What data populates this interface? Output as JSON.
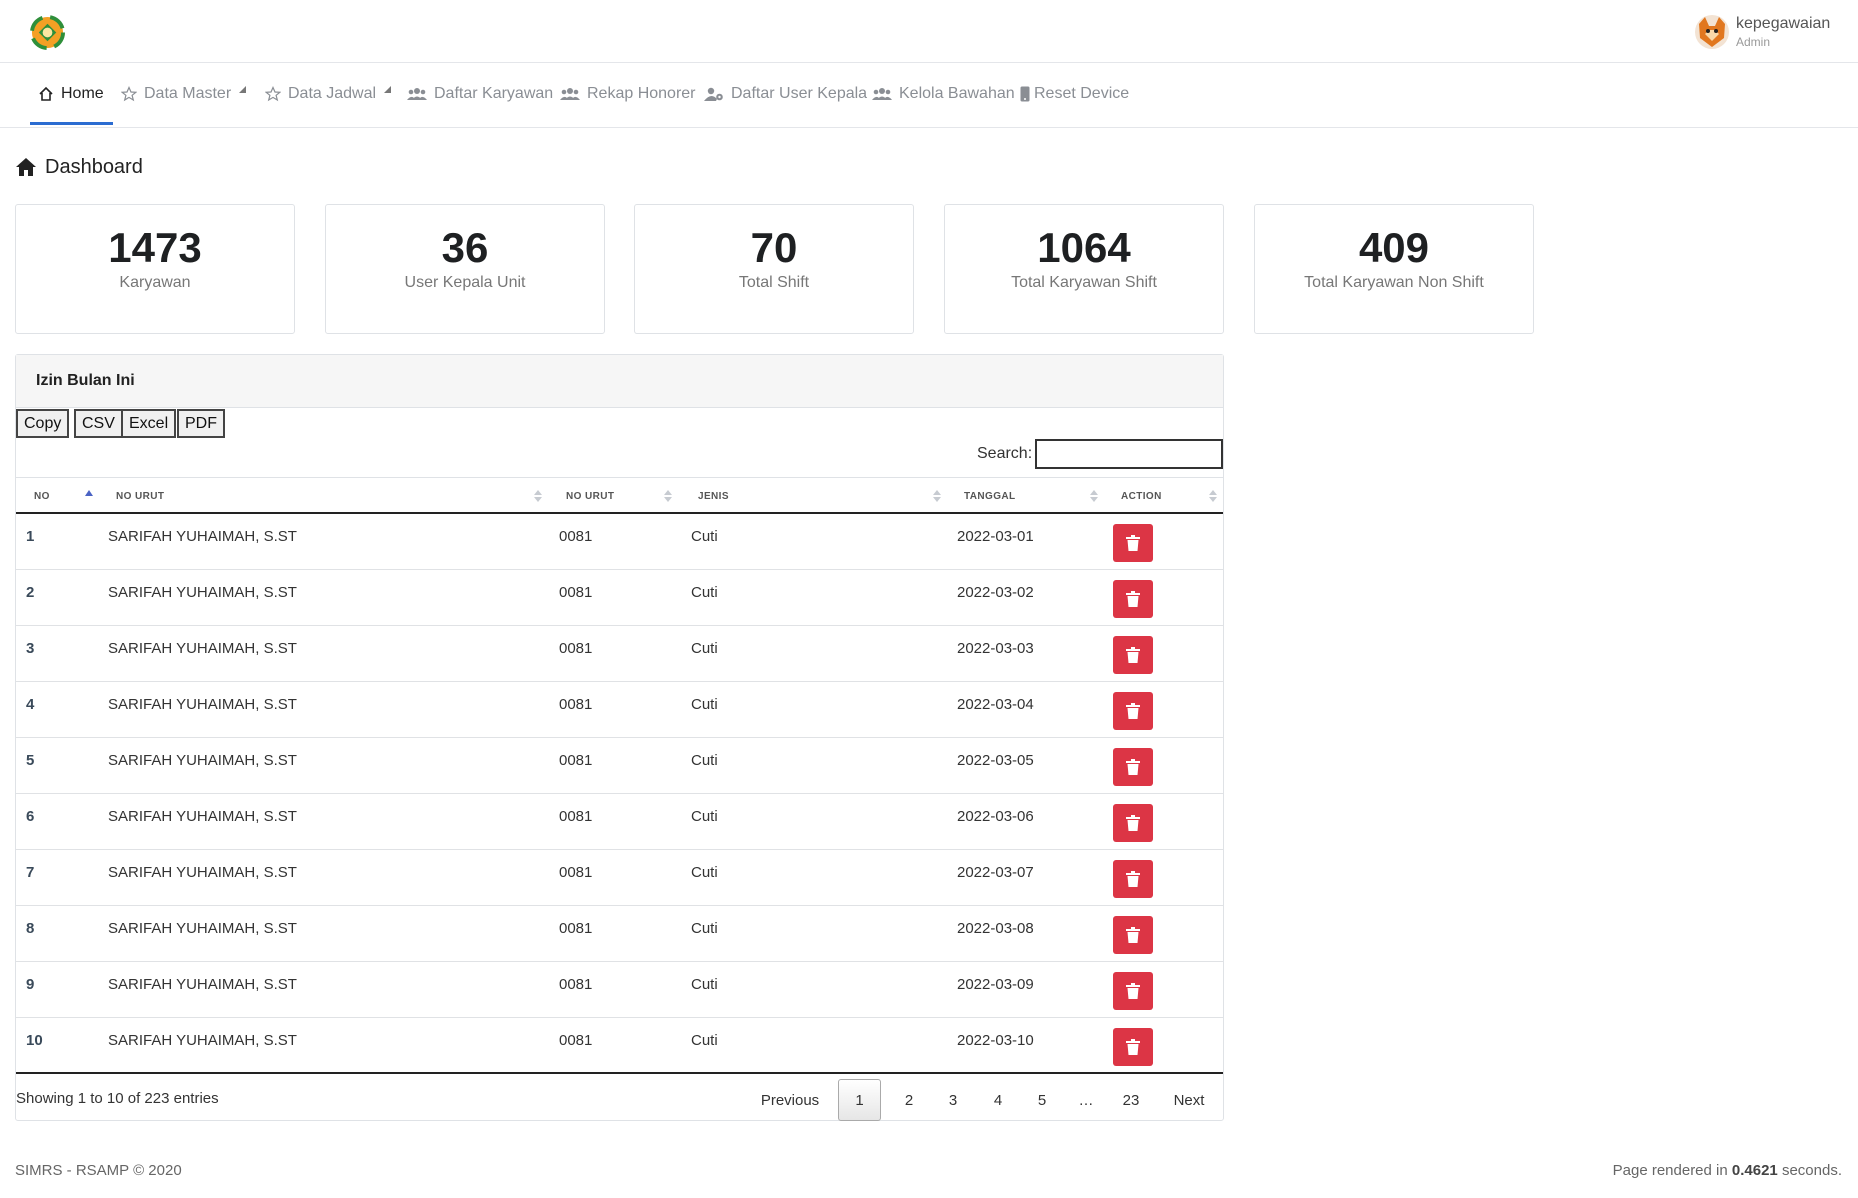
{
  "user": {
    "name": "kepegawaian",
    "role": "Admin"
  },
  "nav": [
    {
      "label": "Home",
      "active": true,
      "icon": "home-icon"
    },
    {
      "label": "Data Master",
      "icon": "star-icon",
      "dropdown": true
    },
    {
      "label": "Data Jadwal",
      "icon": "star-icon",
      "dropdown": true
    },
    {
      "label": "Daftar Karyawan",
      "icon": "users-icon"
    },
    {
      "label": "Rekap Honorer",
      "icon": "users-icon"
    },
    {
      "label": "Daftar User Kepala",
      "icon": "user-cog-icon"
    },
    {
      "label": "Kelola Bawahan",
      "icon": "users-icon"
    },
    {
      "label": "Reset Device",
      "icon": "mobile-icon"
    }
  ],
  "page_title": "Dashboard",
  "stats": [
    {
      "value": "1473",
      "label": "Karyawan"
    },
    {
      "value": "36",
      "label": "User Kepala Unit"
    },
    {
      "value": "70",
      "label": "Total Shift"
    },
    {
      "value": "1064",
      "label": "Total Karyawan Shift"
    },
    {
      "value": "409",
      "label": "Total Karyawan Non Shift"
    }
  ],
  "panel": {
    "title": "Izin Bulan Ini",
    "export_buttons": [
      "Copy",
      "CSV",
      "Excel",
      "PDF"
    ],
    "search_label": "Search:",
    "search_value": "",
    "columns": [
      "NO",
      "NO URUT",
      "NO URUT",
      "JENIS",
      "TANGGAL",
      "ACTION"
    ],
    "rows": [
      {
        "no": "1",
        "nama": "SARIFAH YUHAIMAH, S.ST",
        "no_urut": "0081",
        "jenis": "Cuti",
        "tanggal": "2022-03-01"
      },
      {
        "no": "2",
        "nama": "SARIFAH YUHAIMAH, S.ST",
        "no_urut": "0081",
        "jenis": "Cuti",
        "tanggal": "2022-03-02"
      },
      {
        "no": "3",
        "nama": "SARIFAH YUHAIMAH, S.ST",
        "no_urut": "0081",
        "jenis": "Cuti",
        "tanggal": "2022-03-03"
      },
      {
        "no": "4",
        "nama": "SARIFAH YUHAIMAH, S.ST",
        "no_urut": "0081",
        "jenis": "Cuti",
        "tanggal": "2022-03-04"
      },
      {
        "no": "5",
        "nama": "SARIFAH YUHAIMAH, S.ST",
        "no_urut": "0081",
        "jenis": "Cuti",
        "tanggal": "2022-03-05"
      },
      {
        "no": "6",
        "nama": "SARIFAH YUHAIMAH, S.ST",
        "no_urut": "0081",
        "jenis": "Cuti",
        "tanggal": "2022-03-06"
      },
      {
        "no": "7",
        "nama": "SARIFAH YUHAIMAH, S.ST",
        "no_urut": "0081",
        "jenis": "Cuti",
        "tanggal": "2022-03-07"
      },
      {
        "no": "8",
        "nama": "SARIFAH YUHAIMAH, S.ST",
        "no_urut": "0081",
        "jenis": "Cuti",
        "tanggal": "2022-03-08"
      },
      {
        "no": "9",
        "nama": "SARIFAH YUHAIMAH, S.ST",
        "no_urut": "0081",
        "jenis": "Cuti",
        "tanggal": "2022-03-09"
      },
      {
        "no": "10",
        "nama": "SARIFAH YUHAIMAH, S.ST",
        "no_urut": "0081",
        "jenis": "Cuti",
        "tanggal": "2022-03-10"
      }
    ],
    "info": "Showing 1 to 10 of 223 entries",
    "pagination": [
      "Previous",
      "1",
      "2",
      "3",
      "4",
      "5",
      "…",
      "23",
      "Next"
    ],
    "current_page": "1"
  },
  "footer": {
    "left": "SIMRS - RSAMP © 2020",
    "right_prefix": "Page rendered in ",
    "right_value": "0.4621",
    "right_suffix": " seconds."
  },
  "colors": {
    "accent": "#2b6cd1",
    "danger": "#dc3545"
  }
}
